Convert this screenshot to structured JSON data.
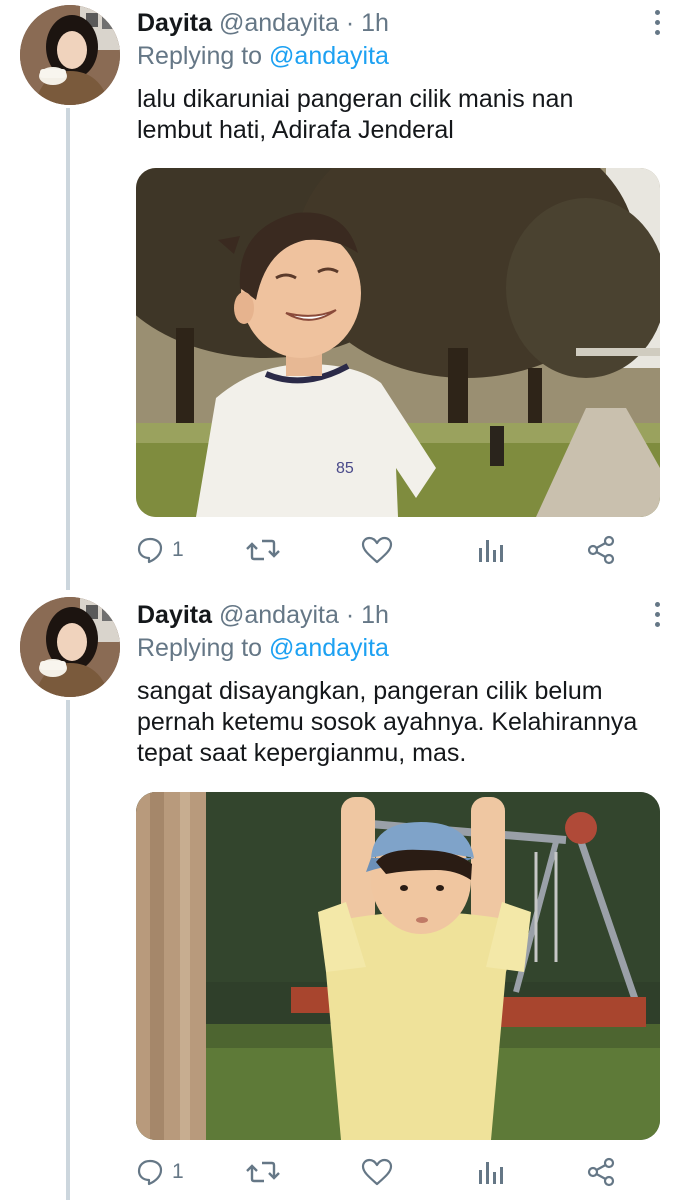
{
  "tweets": [
    {
      "author": "Dayita",
      "handle": "@andayita",
      "separator": "·",
      "time": "1h",
      "replying_prefix": "Replying to",
      "replying_handle": "@andayita",
      "text_lines": [
        "lalu dikaruniai pangeran cilik manis nan",
        "lembut hati, Adirafa Jenderal"
      ],
      "media": {
        "subject": "smiling boy in white t-shirt in park",
        "shirt_text": "85"
      },
      "actions": {
        "reply_count": "1",
        "retweet_count": "",
        "like_count": ""
      }
    },
    {
      "author": "Dayita",
      "handle": "@andayita",
      "separator": "·",
      "time": "1h",
      "replying_prefix": "Replying to",
      "replying_handle": "@andayita",
      "text_lines": [
        "sangat disayangkan, pangeran cilik belum",
        "pernah ketemu sosok ayahnya. Kelahirannya",
        "tepat saat kepergianmu, mas."
      ],
      "media": {
        "subject": "boy in blue cap and yellow shirt at playground"
      },
      "actions": {
        "reply_count": "1",
        "retweet_count": "",
        "like_count": ""
      }
    }
  ],
  "icons": {
    "reply": "reply-icon",
    "retweet": "retweet-icon",
    "like": "like-icon",
    "analytics": "analytics-icon",
    "share": "share-icon",
    "more": "more-icon"
  },
  "colors": {
    "text_primary": "#14171a",
    "text_secondary": "#657786",
    "link": "#1da1f2",
    "thread_line": "#ccd6dd"
  }
}
